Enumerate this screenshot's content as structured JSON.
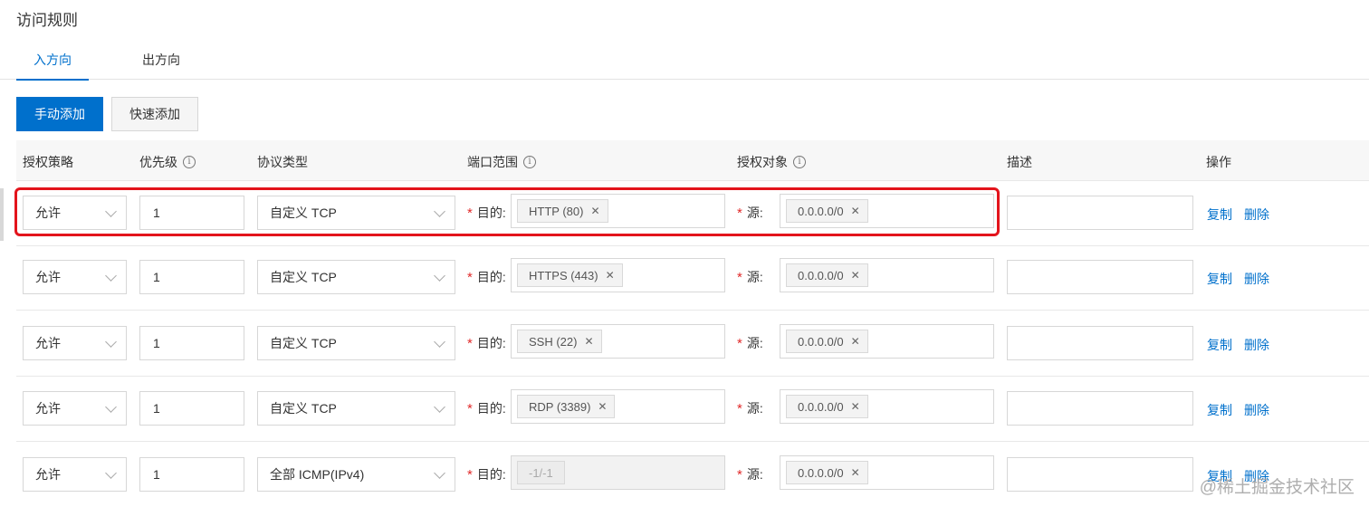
{
  "page": {
    "title": "访问规则"
  },
  "tabs": [
    {
      "label": "入方向",
      "active": true
    },
    {
      "label": "出方向",
      "active": false
    }
  ],
  "toolbar": {
    "manual_add": "手动添加",
    "quick_add": "快速添加"
  },
  "columns": {
    "policy": "授权策略",
    "priority": "优先级",
    "protocol": "协议类型",
    "port_range": "端口范围",
    "auth_object": "授权对象",
    "description": "描述",
    "actions": "操作"
  },
  "labels": {
    "dest": "目的:",
    "source": "源:",
    "required": "*"
  },
  "rules": [
    {
      "policy": "允许",
      "priority": "1",
      "protocol": "自定义 TCP",
      "port": "HTTP (80)",
      "port_disabled": false,
      "source": "0.0.0.0/0",
      "description": "",
      "copy": "复制",
      "delete": "删除"
    },
    {
      "policy": "允许",
      "priority": "1",
      "protocol": "自定义 TCP",
      "port": "HTTPS (443)",
      "port_disabled": false,
      "source": "0.0.0.0/0",
      "description": "",
      "copy": "复制",
      "delete": "删除"
    },
    {
      "policy": "允许",
      "priority": "1",
      "protocol": "自定义 TCP",
      "port": "SSH (22)",
      "port_disabled": false,
      "source": "0.0.0.0/0",
      "description": "",
      "copy": "复制",
      "delete": "删除"
    },
    {
      "policy": "允许",
      "priority": "1",
      "protocol": "自定义 TCP",
      "port": "RDP (3389)",
      "port_disabled": false,
      "source": "0.0.0.0/0",
      "description": "",
      "copy": "复制",
      "delete": "删除"
    },
    {
      "policy": "允许",
      "priority": "1",
      "protocol": "全部 ICMP(IPv4)",
      "port": "-1/-1",
      "port_disabled": true,
      "source": "0.0.0.0/0",
      "description": "",
      "copy": "复制",
      "delete": "删除"
    }
  ],
  "watermark": "@稀土掘金技术社区",
  "colors": {
    "accent": "#0070cc",
    "required": "#e12a2a",
    "highlight": "#e3141c"
  }
}
